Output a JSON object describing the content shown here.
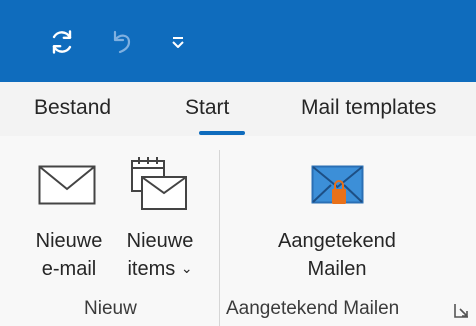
{
  "quick_access": {
    "sync_icon": "sync-icon",
    "undo_icon": "undo-icon",
    "customize_icon": "customize-quick-access-icon"
  },
  "tabs": [
    {
      "label": "Bestand",
      "active": false
    },
    {
      "label": "Start",
      "active": true
    },
    {
      "label": "Mail templates",
      "active": false
    }
  ],
  "groups": {
    "nieuw": {
      "label": "Nieuw",
      "new_email": {
        "line1": "Nieuwe",
        "line2": "e-mail"
      },
      "new_items": {
        "line1": "Nieuwe",
        "line2": "items",
        "chevron": "˅"
      }
    },
    "aangetekend": {
      "label": "Aangetekend Mailen",
      "button": {
        "line1": "Aangetekend",
        "line2": "Mailen"
      }
    }
  },
  "colors": {
    "accent": "#0f6cbd",
    "registered_orange": "#e8711a"
  }
}
